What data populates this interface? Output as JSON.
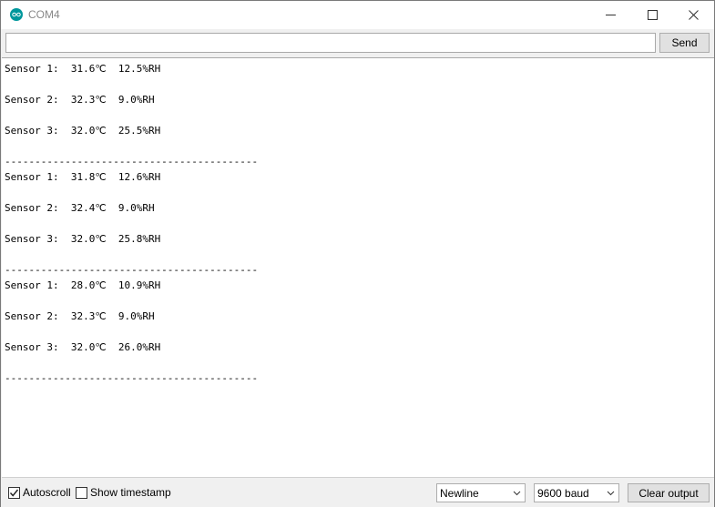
{
  "window": {
    "title": "COM4",
    "accent_color": "#00979c"
  },
  "send_bar": {
    "input_value": "",
    "send_label": "Send"
  },
  "output": {
    "lines": [
      "Sensor 1:  31.6℃  12.5%RH",
      "Sensor 2:  32.3℃  9.0%RH",
      "Sensor 3:  32.0℃  25.5%RH",
      "------------------------------------------",
      "Sensor 1:  31.8℃  12.6%RH",
      "Sensor 2:  32.4℃  9.0%RH",
      "Sensor 3:  32.0℃  25.8%RH",
      "------------------------------------------",
      "Sensor 1:  28.0℃  10.9%RH",
      "Sensor 2:  32.3℃  9.0%RH",
      "Sensor 3:  32.0℃  26.0%RH",
      "------------------------------------------"
    ]
  },
  "bottom_bar": {
    "autoscroll_label": "Autoscroll",
    "autoscroll_checked": true,
    "timestamp_label": "Show timestamp",
    "timestamp_checked": false,
    "line_ending": "Newline",
    "baud_rate": "9600 baud",
    "clear_label": "Clear output"
  }
}
